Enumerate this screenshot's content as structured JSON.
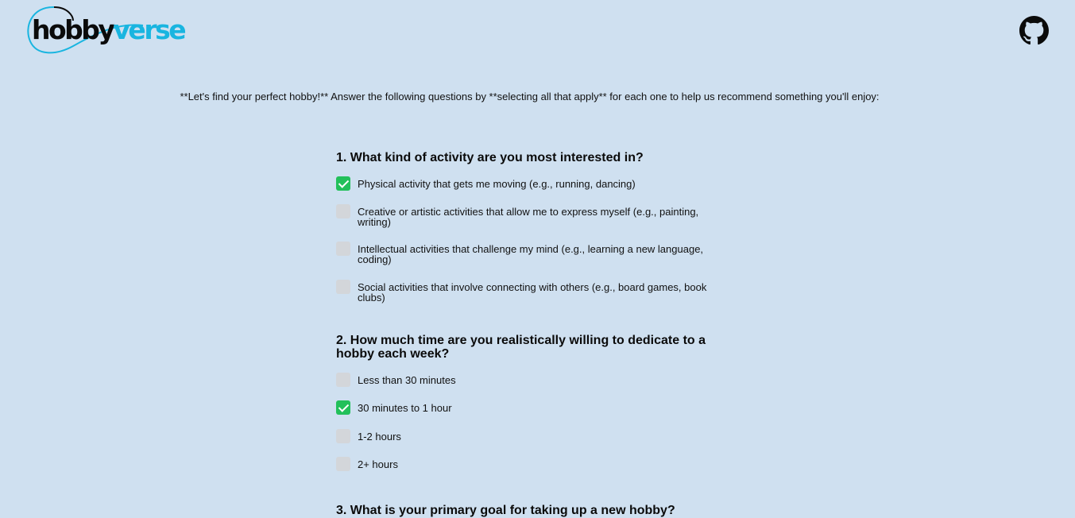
{
  "header": {
    "logo_part1": "hobby",
    "logo_part2": "verse",
    "github_icon": "github-icon"
  },
  "intro": "**Let's find your perfect hobby!** Answer the following questions by **selecting all that apply** for each one to help us recommend something you'll enjoy:",
  "questions": [
    {
      "title": "1. What kind of activity are you most interested in?",
      "options": [
        {
          "label": "Physical activity that gets me moving (e.g., running, dancing)",
          "checked": true
        },
        {
          "label": "Creative or artistic activities that allow me to express myself (e.g., painting, writing)",
          "checked": false
        },
        {
          "label": "Intellectual activities that challenge my mind (e.g., learning a new language, coding)",
          "checked": false
        },
        {
          "label": "Social activities that involve connecting with others (e.g., board games, book clubs)",
          "checked": false
        }
      ]
    },
    {
      "title": "2. How much time are you realistically willing to dedicate to a hobby each week?",
      "options": [
        {
          "label": "Less than 30 minutes",
          "checked": false
        },
        {
          "label": "30 minutes to 1 hour",
          "checked": true
        },
        {
          "label": "1-2 hours",
          "checked": false
        },
        {
          "label": "2+ hours",
          "checked": false
        }
      ]
    },
    {
      "title": "3. What is your primary goal for taking up a new hobby?",
      "options": []
    }
  ],
  "colors": {
    "background": "#cfe0f0",
    "checked": "#22c05a",
    "unchecked": "#d3d6da",
    "brand_accent": "#19b5e0"
  }
}
